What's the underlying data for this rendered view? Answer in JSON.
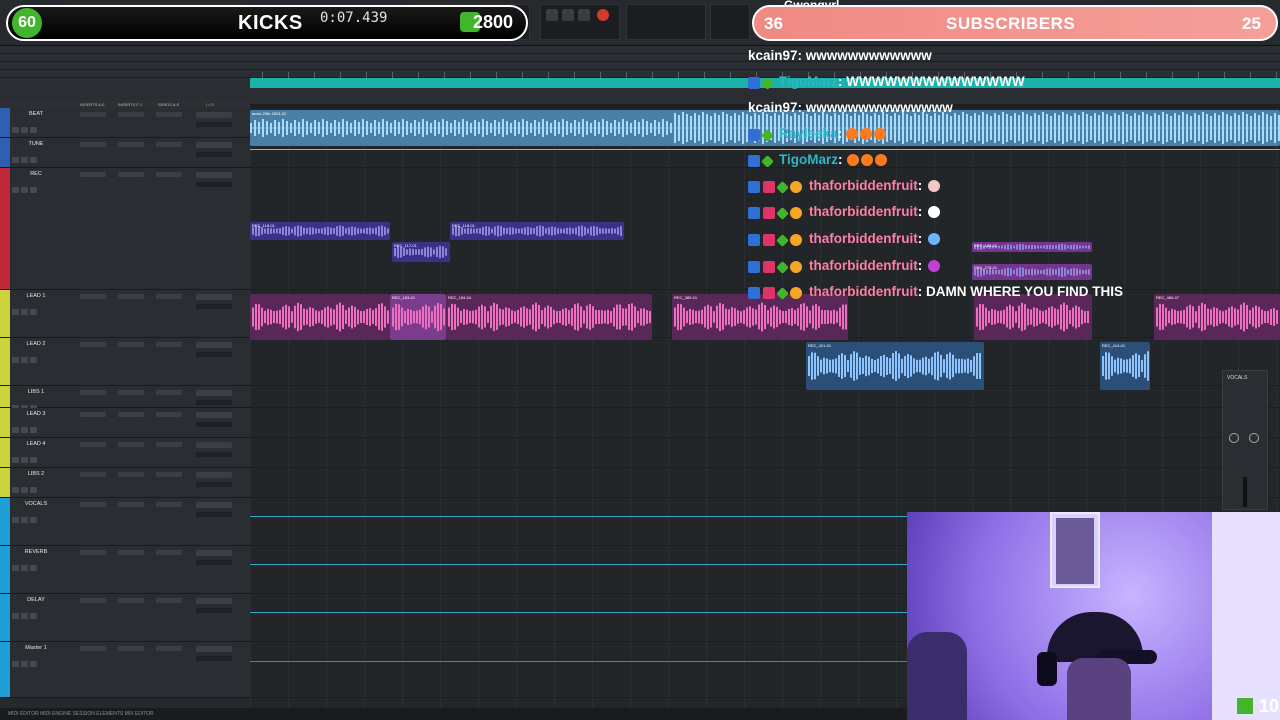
{
  "overlay": {
    "kicks_count": "60",
    "kicks_label": "KICKS",
    "counter": "0:07.439",
    "score": "2800",
    "subscriber_count": "36",
    "subscriber_label": "SUBSCRIBERS",
    "subscriber_goal": "25",
    "ticker_text": "Gwongyrl",
    "cam_corner_number": "10"
  },
  "tracks": [
    {
      "name": "BEAT",
      "color": "#2f5fb0"
    },
    {
      "name": "TUNE",
      "color": "#2f5fb0"
    },
    {
      "name": "REC",
      "color": "#c0283a"
    },
    {
      "name": "LEAD 1",
      "color": "#cbd23a"
    },
    {
      "name": "LEAD 2",
      "color": "#cbd23a"
    },
    {
      "name": "LIBS 1",
      "color": "#cbd23a"
    },
    {
      "name": "LEAD 3",
      "color": "#cbd23a"
    },
    {
      "name": "LEAD 4",
      "color": "#cbd23a"
    },
    {
      "name": "LIBS 2",
      "color": "#cbd23a"
    },
    {
      "name": "VOCALS",
      "color": "#1f9ed6"
    },
    {
      "name": "REVERB",
      "color": "#1f9ed6"
    },
    {
      "name": "DELAY",
      "color": "#1f9ed6"
    },
    {
      "name": "Master 1",
      "color": "#1f9ed6"
    }
  ],
  "col_headers": {
    "inserts_ae": "INSERTS A-E",
    "inserts_fj": "INSERTS F-J",
    "sends_ae": "SENDS A-E",
    "io": "I / O"
  },
  "clips": {
    "beat": "ardor-29th 2024-02",
    "rec1": "REC_116-01",
    "rec2": "REC_117-01",
    "rec3": "REC_186-01",
    "rec4": "REC_187-01",
    "rec5": "REC_278-01",
    "lead1a": "REC_183-01",
    "lead1b": "REC_184-04",
    "lead1c": "REC_389-01",
    "lead1d": "REC_466-07",
    "lead2a": "REC_421-01",
    "lead2b": "REC_414-01"
  },
  "chat": [
    {
      "user": "kcain97",
      "text": ": wwwwwwwwwwww",
      "style": "plain"
    },
    {
      "user": "TigoMarz",
      "text": ": WWWWWWWWWWWWWW",
      "style": "teal"
    },
    {
      "user": "kcain97",
      "text": ": wwwwwwwwwwwwww",
      "style": "plain"
    },
    {
      "user": "Rayleeka",
      "text": ":",
      "style": "teal"
    },
    {
      "user": "TigoMarz",
      "text": ":",
      "style": "teal"
    },
    {
      "user": "thaforbiddenfruit",
      "text": ":",
      "style": "pink"
    },
    {
      "user": "thaforbiddenfruit",
      "text": ":",
      "style": "pink"
    },
    {
      "user": "thaforbiddenfruit",
      "text": ":",
      "style": "pink"
    },
    {
      "user": "thaforbiddenfruit",
      "text": ":",
      "style": "pink"
    },
    {
      "user": "thaforbiddenfruit",
      "text": ": DAMN WHERE YOU FIND THIS",
      "style": "pink"
    }
  ],
  "mini_panel": {
    "title": "VOCALS"
  },
  "bottom_bar": "MIDI EDITOR   MIDI ENGINE   SESSION ELEMENTS   MIX EDITOR"
}
